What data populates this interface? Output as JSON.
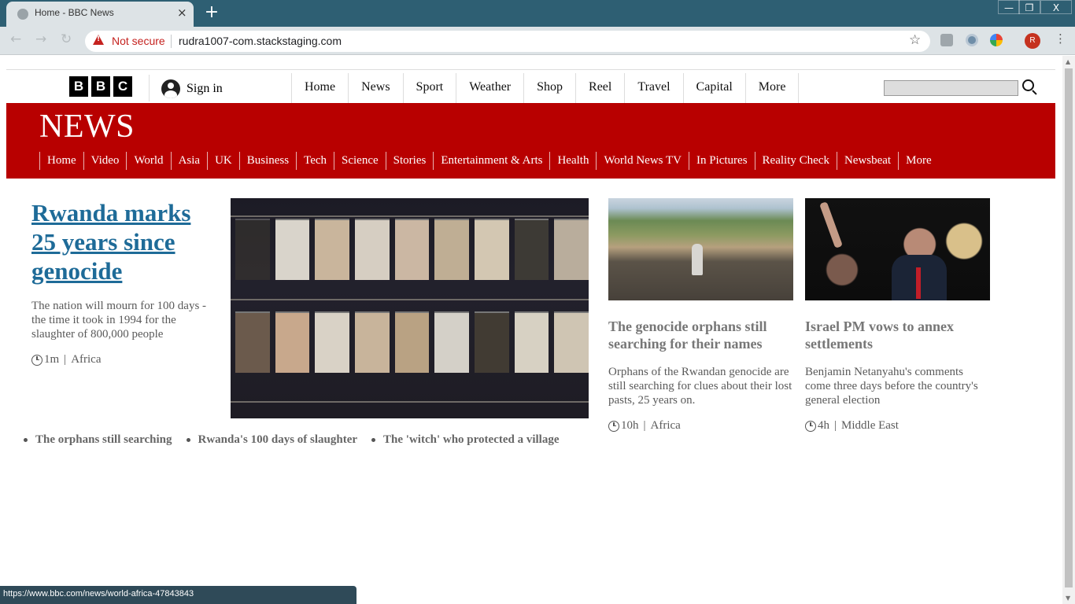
{
  "browser": {
    "tab_title": "Home - BBC News",
    "tab_close": "×",
    "new_tab": "+",
    "window_controls": {
      "minimize": "—",
      "maximize": "❐",
      "close": "X"
    },
    "security_label": "Not secure",
    "url": "rudra1007-com.stackstaging.com",
    "profile_initial": "R",
    "status_url": "https://www.bbc.com/news/world-africa-47843843",
    "icons": {
      "back": "arrow-left-icon",
      "forward": "arrow-right-icon",
      "reload": "reload-icon",
      "bookmark": "star-icon",
      "menu": "kebab-icon"
    }
  },
  "bbc_header": {
    "logo_letters": [
      "B",
      "B",
      "C"
    ],
    "signin_label": "Sign in",
    "nav": [
      "Home",
      "News",
      "Sport",
      "Weather",
      "Shop",
      "Reel",
      "Travel",
      "Capital",
      "More"
    ],
    "search_value": ""
  },
  "news_band": {
    "title": "NEWS",
    "nav": [
      "Home",
      "Video",
      "World",
      "Asia",
      "UK",
      "Business",
      "Tech",
      "Science",
      "Stories",
      "Entertainment & Arts",
      "Health",
      "World News TV",
      "In Pictures",
      "Reality Check",
      "Newsbeat",
      "More"
    ]
  },
  "lead_story": {
    "headline": "Rwanda marks 25 years since genocide",
    "summary": "The nation will mourn for 100 days - the time it took in 1994 for the slaughter of 800,000 people",
    "time": "1m",
    "section": "Africa"
  },
  "related_links": [
    "The orphans still searching",
    "Rwanda's 100 days of slaughter",
    "The 'witch' who protected a village"
  ],
  "stories": [
    {
      "headline": "The genocide orphans still searching for their names",
      "summary": "Orphans of the Rwandan genocide are still searching for clues about their lost pasts, 25 years on.",
      "time": "10h",
      "section": "Africa"
    },
    {
      "headline": "Israel PM vows to annex settlements",
      "summary": "Benjamin Netanyahu's comments come three days before the country's general election",
      "time": "4h",
      "section": "Middle East"
    }
  ],
  "colors": {
    "bbc_red": "#b80000",
    "link_blue": "#1e6b98",
    "chrome": "#2e5f73"
  }
}
